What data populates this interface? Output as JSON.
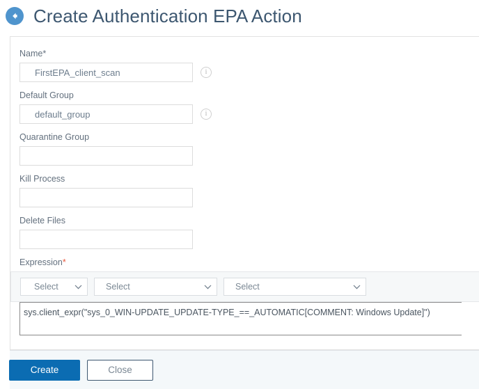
{
  "header": {
    "back_icon": "arrow-left-circle-icon",
    "title": "Create Authentication EPA Action",
    "accent_color": "#4f94cd",
    "title_color": "#3d5770"
  },
  "form": {
    "fields": [
      {
        "label": "Name*",
        "value": "FirstEPA_client_scan",
        "placeholder": "",
        "has_info_icon": true,
        "info_icon": "info-circle-icon",
        "name": "name"
      },
      {
        "label": "Default Group",
        "value": "default_group",
        "placeholder": "",
        "has_info_icon": true,
        "info_icon": "info-circle-icon",
        "name": "default-group"
      },
      {
        "label": "Quarantine Group",
        "value": "",
        "placeholder": "",
        "has_info_icon": false,
        "info_icon": "",
        "name": "quarantine-group"
      },
      {
        "label": "Kill Process",
        "value": "",
        "placeholder": "",
        "has_info_icon": false,
        "info_icon": "",
        "name": "kill-process"
      },
      {
        "label": "Delete Files",
        "value": "",
        "placeholder": "",
        "has_info_icon": false,
        "info_icon": "",
        "name": "delete-files"
      }
    ],
    "expression": {
      "label": "Expression",
      "required_marker": "*",
      "required_color": "#e8583c",
      "selects": [
        {
          "value": "Select",
          "chevron": "chevron-down-icon"
        },
        {
          "value": "Select",
          "chevron": "chevron-down-icon"
        },
        {
          "value": "Select",
          "chevron": "chevron-down-icon"
        }
      ],
      "text": "sys.client_expr(\"sys_0_WIN-UPDATE_UPDATE-TYPE_==_AUTOMATIC[COMMENT: Windows Update]\")"
    }
  },
  "footer": {
    "create_label": "Create",
    "close_label": "Close",
    "primary_color": "#0b6cb2"
  }
}
